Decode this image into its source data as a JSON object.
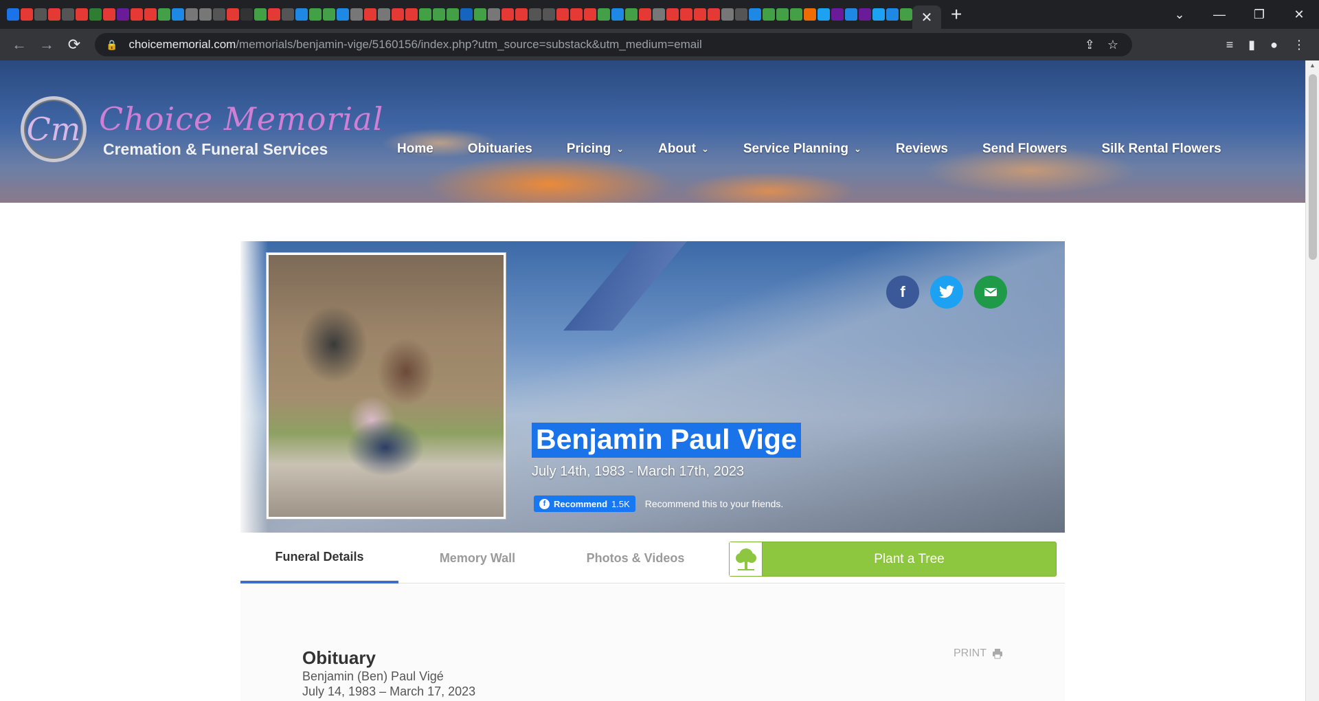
{
  "browser": {
    "close_tab_glyph": "✕",
    "new_tab_glyph": "+",
    "url_host": "choicememorial.com",
    "url_path": "/memorials/benjamin-vige/5160156/index.php?utm_source=substack&utm_medium=email",
    "favicon_colors": [
      "#1a73e8",
      "#e53935",
      "#555",
      "#e53935",
      "#555",
      "#e53935",
      "#2e7d32",
      "#e53935",
      "#6a1b9a",
      "#e53935",
      "#e53935",
      "#43a047",
      "#1e88e5",
      "#777",
      "#777",
      "#555",
      "#e53935",
      "#333",
      "#43a047",
      "#e53935",
      "#555",
      "#1e88e5",
      "#43a047",
      "#43a047",
      "#1e88e5",
      "#777",
      "#e53935",
      "#777",
      "#e53935",
      "#e53935",
      "#43a047",
      "#43a047",
      "#43a047",
      "#1565c0",
      "#43a047",
      "#777",
      "#e53935",
      "#e53935",
      "#555",
      "#555",
      "#e53935",
      "#e53935",
      "#e53935",
      "#43a047",
      "#1e88e5",
      "#43a047",
      "#e53935",
      "#777",
      "#e53935",
      "#e53935",
      "#e53935",
      "#e53935",
      "#777",
      "#555",
      "#1e88e5",
      "#43a047",
      "#43a047",
      "#43a047",
      "#ef6c00",
      "#1da1f2",
      "#6a1b9a",
      "#1e88e5",
      "#6a1b9a",
      "#1da1f2",
      "#1e88e5",
      "#43a047"
    ]
  },
  "site": {
    "logo_mark": "Cm",
    "logo_title": "Choice Memorial",
    "logo_subtitle": "Cremation & Funeral Services",
    "nav": [
      {
        "label": "Home",
        "dropdown": false
      },
      {
        "label": "Obituaries",
        "dropdown": false
      },
      {
        "label": "Pricing",
        "dropdown": true
      },
      {
        "label": "About",
        "dropdown": true
      },
      {
        "label": "Service Planning",
        "dropdown": true
      },
      {
        "label": "Reviews",
        "dropdown": false
      },
      {
        "label": "Send Flowers",
        "dropdown": false
      },
      {
        "label": "Silk Rental Flowers",
        "dropdown": false
      }
    ]
  },
  "memorial": {
    "name": "Benjamin Paul Vige",
    "dates": "July 14th, 1983 - March 17th, 2023",
    "fb_recommend_label": "Recommend",
    "fb_count": "1.5K",
    "recommend_text": "Recommend this to your friends.",
    "share_icons": [
      "facebook-icon",
      "twitter-icon",
      "email-icon"
    ]
  },
  "tabs": [
    {
      "label": "Funeral Details",
      "active": true
    },
    {
      "label": "Memory Wall",
      "active": false
    },
    {
      "label": "Photos & Videos",
      "active": false
    }
  ],
  "plant_tree_label": "Plant a Tree",
  "obituary": {
    "title": "Obituary",
    "print_label": "PRINT",
    "line1": "Benjamin (Ben) Paul Vigé",
    "line2": "July 14, 1983 – March 17, 2023"
  },
  "colors": {
    "accent_blue": "#3f6fc4",
    "plant_green": "#8dc63f",
    "selection": "#1a73e8"
  }
}
